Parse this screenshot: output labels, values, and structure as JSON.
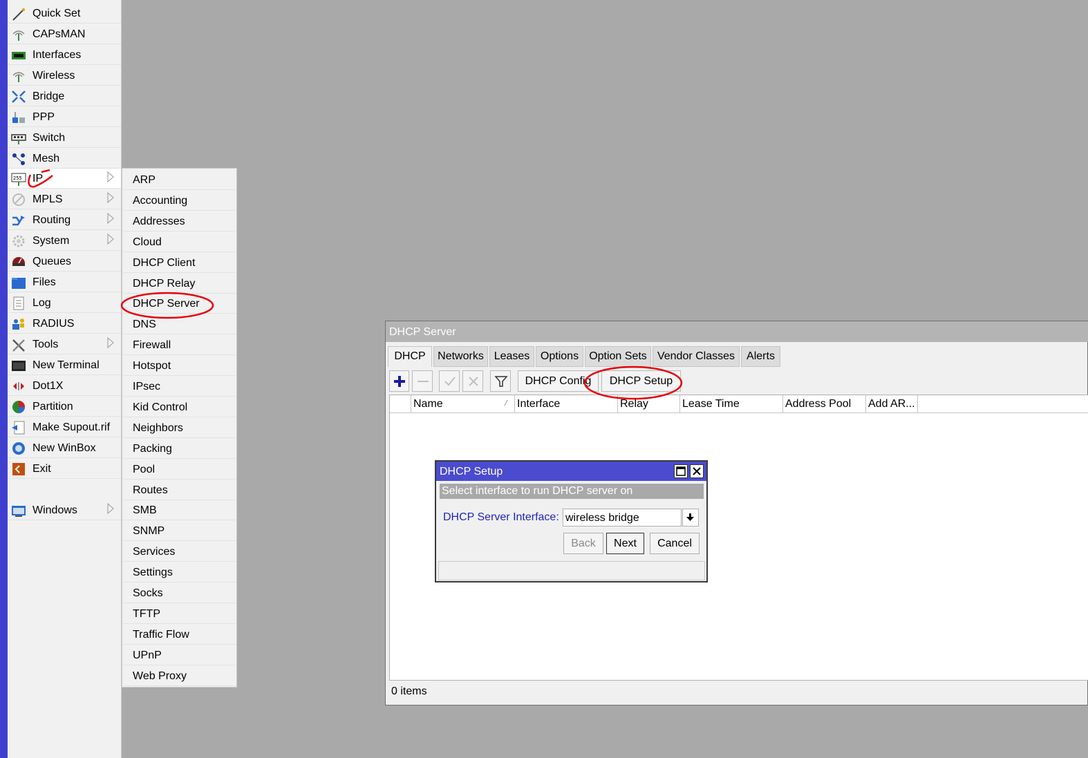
{
  "main_menu": {
    "items": [
      {
        "label": "Quick Set",
        "icon": "wand-icon"
      },
      {
        "label": "CAPsMAN",
        "icon": "antenna-icon"
      },
      {
        "label": "Interfaces",
        "icon": "ethernet-card-icon"
      },
      {
        "label": "Wireless",
        "icon": "antenna-icon"
      },
      {
        "label": "Bridge",
        "icon": "bridge-icon"
      },
      {
        "label": "PPP",
        "icon": "ppp-icon"
      },
      {
        "label": "Switch",
        "icon": "switch-icon"
      },
      {
        "label": "Mesh",
        "icon": "mesh-icon"
      },
      {
        "label": "IP",
        "icon": "ip-icon",
        "submenu": true
      },
      {
        "label": "MPLS",
        "icon": "mpls-icon",
        "submenu": true
      },
      {
        "label": "Routing",
        "icon": "routing-icon",
        "submenu": true
      },
      {
        "label": "System",
        "icon": "gear-icon",
        "submenu": true
      },
      {
        "label": "Queues",
        "icon": "queues-icon"
      },
      {
        "label": "Files",
        "icon": "folder-icon"
      },
      {
        "label": "Log",
        "icon": "log-icon"
      },
      {
        "label": "RADIUS",
        "icon": "users-icon"
      },
      {
        "label": "Tools",
        "icon": "tools-icon",
        "submenu": true
      },
      {
        "label": "New Terminal",
        "icon": "terminal-icon"
      },
      {
        "label": "Dot1X",
        "icon": "dot1x-icon"
      },
      {
        "label": "Partition",
        "icon": "pie-icon"
      },
      {
        "label": "Make Supout.rif",
        "icon": "supout-icon"
      },
      {
        "label": "New WinBox",
        "icon": "winbox-icon"
      },
      {
        "label": "Exit",
        "icon": "exit-icon"
      },
      {
        "label": "Windows",
        "icon": "window-icon",
        "submenu": true
      }
    ]
  },
  "ip_submenu": {
    "items": [
      "ARP",
      "Accounting",
      "Addresses",
      "Cloud",
      "DHCP Client",
      "DHCP Relay",
      "DHCP Server",
      "DNS",
      "Firewall",
      "Hotspot",
      "IPsec",
      "Kid Control",
      "Neighbors",
      "Packing",
      "Pool",
      "Routes",
      "SMB",
      "SNMP",
      "Services",
      "Settings",
      "Socks",
      "TFTP",
      "Traffic Flow",
      "UPnP",
      "Web Proxy"
    ]
  },
  "dhcp_window": {
    "title": "DHCP Server",
    "tabs": [
      "DHCP",
      "Networks",
      "Leases",
      "Options",
      "Option Sets",
      "Vendor Classes",
      "Alerts"
    ],
    "toolbar": {
      "add_icon": "plus-icon",
      "remove_icon": "minus-icon",
      "enable_icon": "check-icon",
      "disable_icon": "x-icon",
      "filter_icon": "filter-icon",
      "dhcp_config": "DHCP Config",
      "dhcp_setup": "DHCP Setup"
    },
    "columns": [
      "Name",
      "Interface",
      "Relay",
      "Lease Time",
      "Address Pool",
      "Add AR..."
    ],
    "status": "0 items"
  },
  "setup_dialog": {
    "title": "DHCP Setup",
    "subtitle": "Select interface to run DHCP server on",
    "interface_label": "DHCP Server Interface:",
    "interface_value": "wireless bridge",
    "back": "Back",
    "next": "Next",
    "cancel": "Cancel"
  },
  "colors": {
    "left_strip": "#3f3fcf",
    "dialog_title": "#4b4bcf",
    "annotation": "#e8000a",
    "field_label": "#2222bb"
  }
}
